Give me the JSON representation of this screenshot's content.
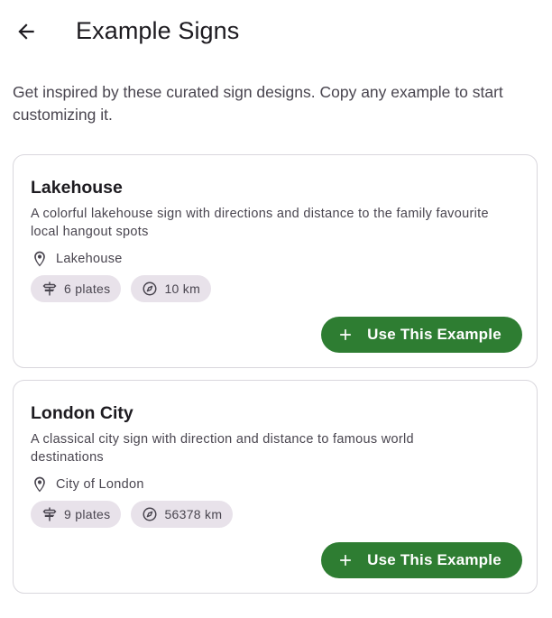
{
  "header": {
    "title": "Example Signs",
    "back_icon": "arrow-back-icon"
  },
  "intro": "Get inspired by these curated sign designs. Copy any example to start customizing it.",
  "examples": [
    {
      "title": "Lakehouse",
      "description": "A colorful lakehouse sign with directions and distance to the family favourite local hangout spots",
      "location": "Lakehouse",
      "plates": "6 plates",
      "distance": "10 km",
      "button_label": "Use This Example"
    },
    {
      "title": "London City",
      "description": "A classical city sign with direction and distance to famous world destinations",
      "location": "City of London",
      "plates": "9 plates",
      "distance": "56378 km",
      "button_label": "Use This Example"
    }
  ],
  "colors": {
    "primary_button": "#2e7d32",
    "chip_bg": "#e8e2ea",
    "card_border": "#d9d7dd"
  }
}
